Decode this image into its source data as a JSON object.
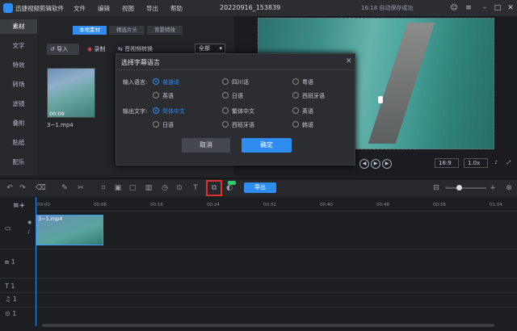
{
  "app": {
    "name": "迅捷视频剪辑软件",
    "menus": [
      "文件",
      "编辑",
      "视图",
      "导出",
      "帮助"
    ],
    "doc_title": "20220916_153839",
    "save_status": "16:18 自动保存成功"
  },
  "sidebar": {
    "items": [
      "素材",
      "文字",
      "特效",
      "转场",
      "滤镜",
      "叠附",
      "贴纸",
      "配乐"
    ]
  },
  "media": {
    "tabs": [
      "本地素材",
      "精选片头",
      "背景特效"
    ],
    "import_label": "导入",
    "record_label": "录制",
    "convert_label": "音视频转换",
    "filter_value": "全部",
    "clip": {
      "name": "3~1.mp4",
      "duration": "00:09"
    }
  },
  "preview": {
    "ratio": "16:9",
    "speed": "1.0x"
  },
  "toolbar": {
    "export_label": "导出"
  },
  "timeline": {
    "ticks": [
      "00:00",
      "00:08",
      "00:16",
      "00:24",
      "00:32",
      "00:40",
      "00:48",
      "00:56",
      "01:04"
    ],
    "clip_name": "3~1.mp4"
  },
  "dialog": {
    "title": "选择字幕语言",
    "input_label": "输入语言:",
    "output_label": "输出文字:",
    "input_options": [
      "普通话",
      "四川话",
      "粤语",
      "英语",
      "日语",
      "西班牙语"
    ],
    "input_selected": "普通话",
    "output_options": [
      "简体中文",
      "繁体中文",
      "英语",
      "日语",
      "西班牙语",
      "韩语"
    ],
    "output_selected": "简体中文",
    "cancel_label": "取消",
    "ok_label": "确定"
  }
}
